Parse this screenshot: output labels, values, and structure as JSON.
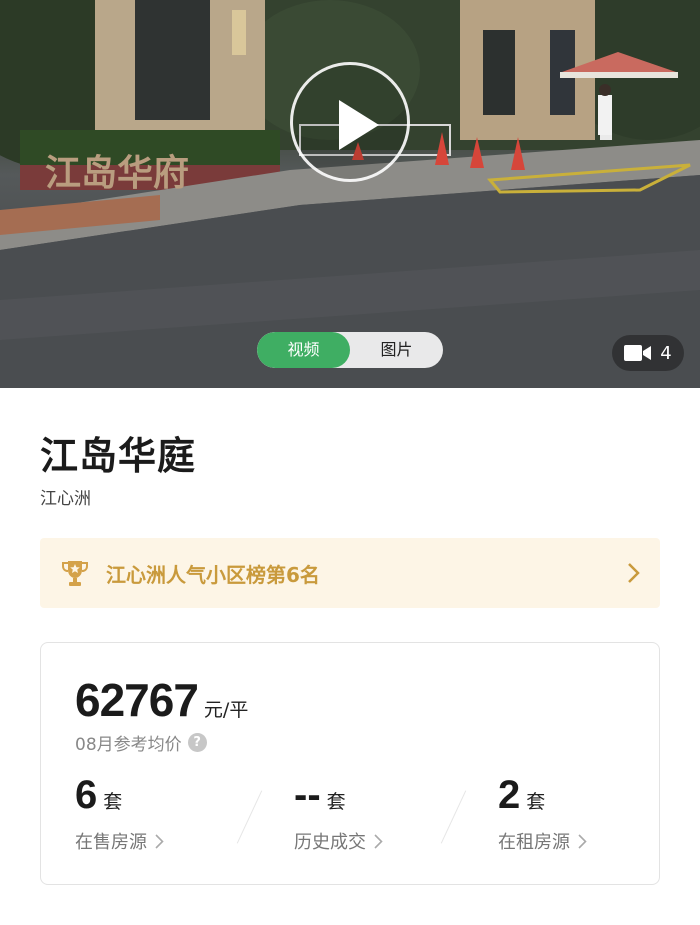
{
  "media": {
    "toggle": {
      "video_label": "视频",
      "photo_label": "图片",
      "active": "video"
    },
    "video_count": "4",
    "scene_sign": "江岛华府"
  },
  "community": {
    "name": "江岛华庭",
    "district": "江心洲"
  },
  "rank_banner": {
    "text": "江心洲人气小区榜第6名",
    "accent_color": "#c99a3c",
    "background_color": "#fdf5e6"
  },
  "stats": {
    "price": {
      "value": "62767",
      "unit": "元/平",
      "label": "08月参考均价",
      "help_icon": "question-circle"
    },
    "items": [
      {
        "value": "6",
        "unit": "套",
        "label": "在售房源"
      },
      {
        "value": "--",
        "unit": "套",
        "label": "历史成交"
      },
      {
        "value": "2",
        "unit": "套",
        "label": "在租房源"
      }
    ]
  },
  "colors": {
    "active_toggle": "#3fae63"
  }
}
